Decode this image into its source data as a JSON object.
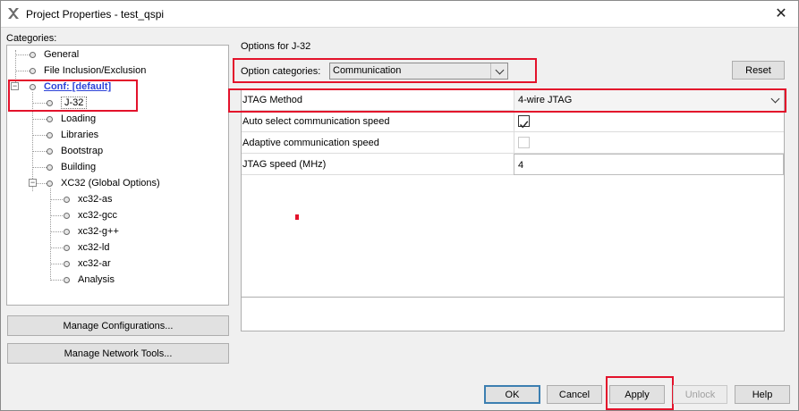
{
  "window": {
    "title": "Project Properties - test_qspi"
  },
  "categories": {
    "heading": "Categories:",
    "items": {
      "general": "General",
      "file_inclusion": "File Inclusion/Exclusion",
      "conf": "Conf: [default]",
      "j32": "J-32",
      "loading": "Loading",
      "libraries": "Libraries",
      "bootstrap": "Bootstrap",
      "building": "Building",
      "xc32": "XC32 (Global Options)",
      "xc32_as": "xc32-as",
      "xc32_gcc": "xc32-gcc",
      "xc32_gpp": "xc32-g++",
      "xc32_ld": "xc32-ld",
      "xc32_ar": "xc32-ar",
      "analysis": "Analysis"
    },
    "selected": "J-32"
  },
  "left_buttons": {
    "manage_configurations": "Manage Configurations...",
    "manage_network_tools": "Manage Network Tools..."
  },
  "options": {
    "heading": "Options for J-32",
    "category_label": "Option categories:",
    "category_value": "Communication",
    "reset_label": "Reset",
    "rows": [
      {
        "label": "JTAG Method",
        "value": "4-wire JTAG"
      },
      {
        "label": "Auto select communication speed",
        "checked": true
      },
      {
        "label": "Adaptive communication speed",
        "checked": false,
        "disabled": true
      },
      {
        "label": "JTAG speed (MHz)",
        "value": "4"
      }
    ]
  },
  "footer": {
    "ok": "OK",
    "cancel": "Cancel",
    "apply": "Apply",
    "unlock": "Unlock",
    "help": "Help"
  },
  "colors": {
    "highlight": "#e3122b",
    "link": "#2c43d8"
  }
}
